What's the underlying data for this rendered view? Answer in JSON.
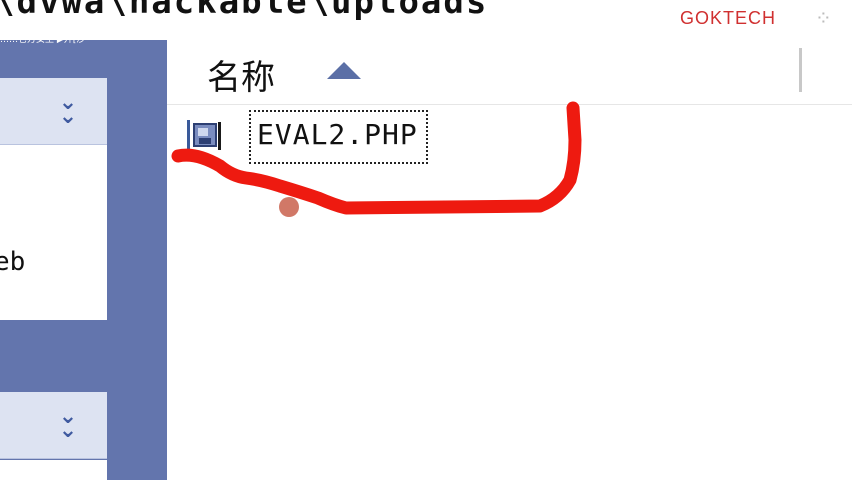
{
  "address_bar": {
    "path": "\\dvwa\\hackable\\uploads"
  },
  "watermark": {
    "text": "GOKTECH",
    "icon": "sparkle-icon"
  },
  "task_pane": {
    "caption": "……它方女王 ▶开[沙",
    "sections": [
      {
        "expand_icon": "double-chevron-down-icon",
        "body_text": "eb"
      },
      {
        "expand_icon": "double-chevron-down-icon",
        "body_text": ""
      }
    ]
  },
  "file_list": {
    "column_name": "名称",
    "sort_direction_icon": "sort-ascending-triangle-icon",
    "files": [
      {
        "name": "EVAL2.PHP",
        "icon": "php-file-icon",
        "selected": true
      }
    ]
  },
  "colors": {
    "task_pane_bg": "#6375ad",
    "annotation_stroke": "#ee1a10",
    "sort_arrow": "#5b6fa6"
  }
}
